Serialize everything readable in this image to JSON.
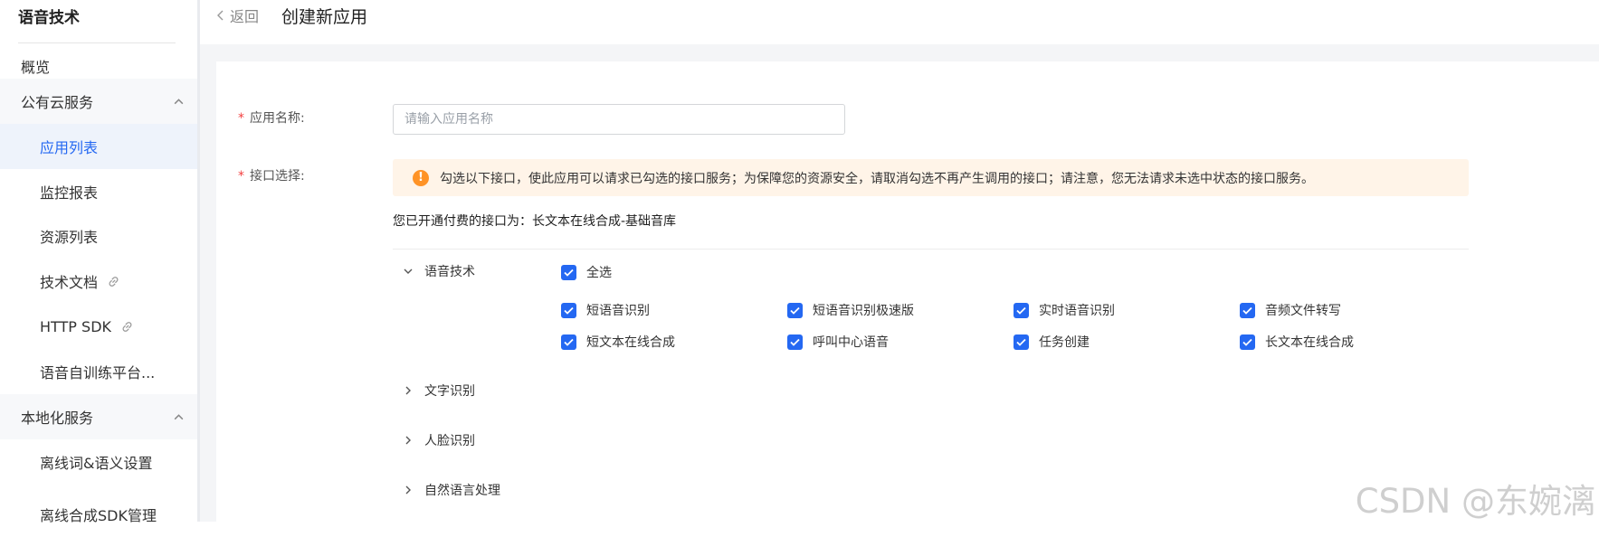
{
  "sidebar": {
    "title": "语音技术",
    "items": [
      {
        "label": "概览"
      },
      {
        "label": "公有云服务"
      },
      {
        "label": "应用列表"
      },
      {
        "label": "监控报表"
      },
      {
        "label": "资源列表"
      },
      {
        "label": "技术文档"
      },
      {
        "label": "HTTP SDK"
      },
      {
        "label": "语音自训练平台..."
      },
      {
        "label": "本地化服务"
      },
      {
        "label": "离线词&语义设置"
      },
      {
        "label": "离线合成SDK管理"
      }
    ]
  },
  "header": {
    "back_label": "返回",
    "title": "创建新应用"
  },
  "form": {
    "name_label": "应用名称:",
    "name_placeholder": "请输入应用名称",
    "name_value": "",
    "api_label": "接口选择:",
    "required_mark": "*",
    "alert_text": "勾选以下接口，使此应用可以请求已勾选的接口服务；为保障您的资源安全，请取消勾选不再产生调用的接口；请注意，您无法请求未选中状态的接口服务。",
    "paid_text": "您已开通付费的接口为：长文本在线合成-基础音库"
  },
  "api_groups": [
    {
      "label": "语音技术",
      "expanded": true
    },
    {
      "label": "文字识别",
      "expanded": false
    },
    {
      "label": "人脸识别",
      "expanded": false
    },
    {
      "label": "自然语言处理",
      "expanded": false
    }
  ],
  "speech_apis": {
    "select_all": "全选",
    "items": [
      {
        "label": "短语音识别",
        "checked": true
      },
      {
        "label": "短语音识别极速版",
        "checked": true
      },
      {
        "label": "实时语音识别",
        "checked": true
      },
      {
        "label": "音频文件转写",
        "checked": true
      },
      {
        "label": "短文本在线合成",
        "checked": true
      },
      {
        "label": "呼叫中心语音",
        "checked": true
      },
      {
        "label": "任务创建",
        "checked": true
      },
      {
        "label": "长文本在线合成",
        "checked": true
      }
    ]
  },
  "watermark": "CSDN @东婉漓",
  "colors": {
    "accent": "#2468f2",
    "warning": "#ff9326",
    "alert_bg": "#fff4e8",
    "required": "#f33e3e"
  }
}
